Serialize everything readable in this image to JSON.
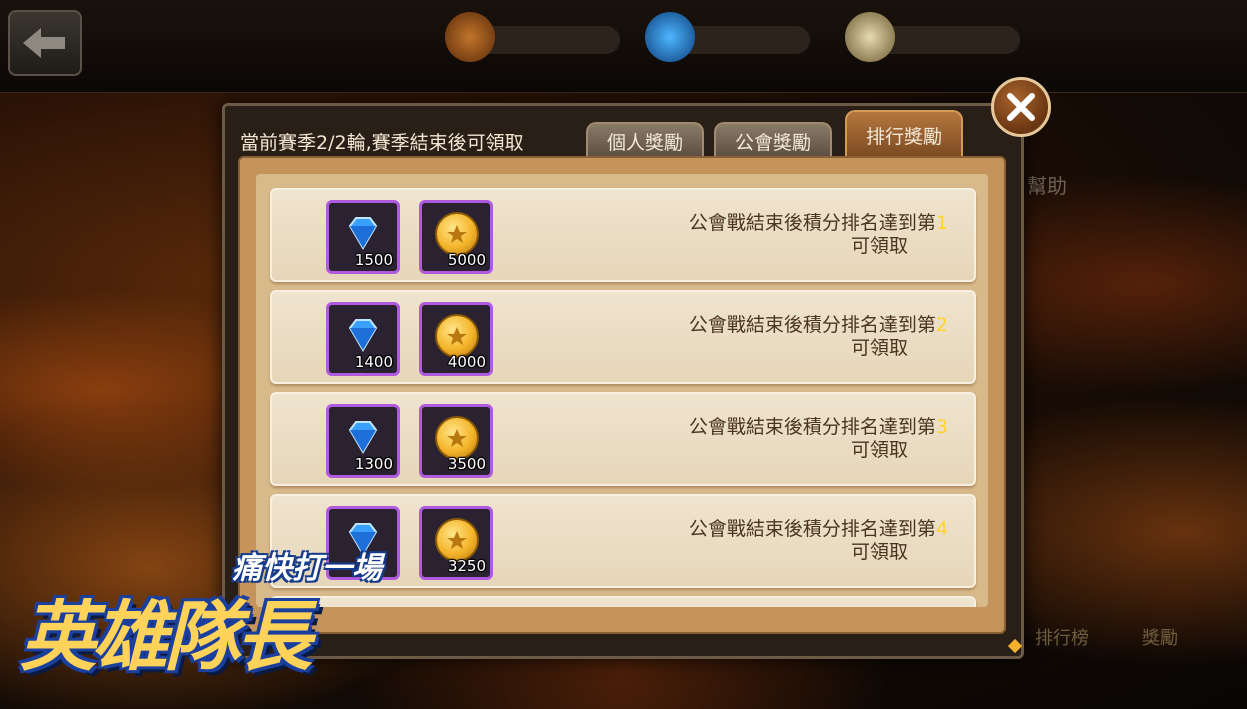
{
  "season_text": "當前賽季2/2輪,賽季結束後可領取",
  "tabs": [
    {
      "label": "個人獎勵",
      "active": false
    },
    {
      "label": "公會獎勵",
      "active": false
    },
    {
      "label": "排行獎勵",
      "active": true
    }
  ],
  "help_label": "幫助",
  "bottom_buttons": {
    "leaderboard": "排行榜",
    "reward": "獎勵"
  },
  "rewards": [
    {
      "gem": "1500",
      "coin": "5000",
      "desc_prefix": "公會戰結束後積分排名達到第",
      "rank": "1",
      "desc_suffix": "可領取"
    },
    {
      "gem": "1400",
      "coin": "4000",
      "desc_prefix": "公會戰結束後積分排名達到第",
      "rank": "2",
      "desc_suffix": "可領取"
    },
    {
      "gem": "1300",
      "coin": "3500",
      "desc_prefix": "公會戰結束後積分排名達到第",
      "rank": "3",
      "desc_suffix": "可領取"
    },
    {
      "gem": "",
      "coin": "3250",
      "desc_prefix": "公會戰結束後積分排名達到第",
      "rank": "4",
      "desc_suffix": "可領取"
    }
  ],
  "logo": {
    "tagline": "痛快打一場",
    "title": "英雄隊長"
  },
  "colors": {
    "rank_highlight": "#ffd42a",
    "item_border": "#b05adf",
    "active_tab": "#b5763d"
  }
}
